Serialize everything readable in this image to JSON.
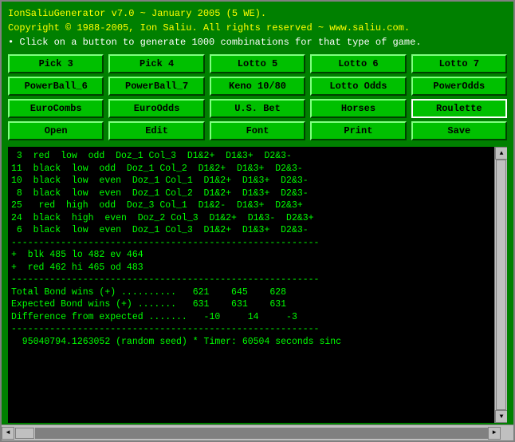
{
  "titlebar": {
    "line1": "IonSaliuGenerator v7.0 ~ January 2005 (5 WE).",
    "line2": "Copyright © 1988-2005, Ion Saliu. All rights reserved ~ www.saliu.com.",
    "line3": "• Click on a button to generate 1000 combinations for that type of game."
  },
  "rows": [
    [
      {
        "label": "Pick 3",
        "name": "pick3-button"
      },
      {
        "label": "Pick 4",
        "name": "pick4-button"
      },
      {
        "label": "Lotto 5",
        "name": "lotto5-button"
      },
      {
        "label": "Lotto 6",
        "name": "lotto6-button"
      },
      {
        "label": "Lotto 7",
        "name": "lotto7-button"
      }
    ],
    [
      {
        "label": "PowerBall_6",
        "name": "powerball6-button"
      },
      {
        "label": "PowerBall_7",
        "name": "powerball7-button"
      },
      {
        "label": "Keno 10/80",
        "name": "keno-button"
      },
      {
        "label": "Lotto Odds",
        "name": "lotto-odds-button"
      },
      {
        "label": "PowerOdds",
        "name": "power-odds-button"
      }
    ],
    [
      {
        "label": "EuroCombs",
        "name": "euro-combs-button"
      },
      {
        "label": "EuroOdds",
        "name": "euro-odds-button"
      },
      {
        "label": "U.S. Bet",
        "name": "us-bet-button"
      },
      {
        "label": "Horses",
        "name": "horses-button"
      },
      {
        "label": "Roulette",
        "name": "roulette-button",
        "special": true
      }
    ],
    [
      {
        "label": "Open",
        "name": "open-button"
      },
      {
        "label": "Edit",
        "name": "edit-button"
      },
      {
        "label": "Font",
        "name": "font-button"
      },
      {
        "label": "Print",
        "name": "print-button"
      },
      {
        "label": "Save",
        "name": "save-button"
      }
    ]
  ],
  "output": {
    "text": " 3  red  low  odd  Doz_1 Col_3  D1&2+  D1&3+  D2&3-\n11  black  low  odd  Doz_1 Col_2  D1&2+  D1&3+  D2&3-\n10  black  low  even  Doz_1 Col_1  D1&2+  D1&3+  D2&3-\n 8  black  low  even  Doz_1 Col_2  D1&2+  D1&3+  D2&3-\n25   red  high  odd  Doz_3 Col_1  D1&2-  D1&3+  D2&3+\n24  black  high  even  Doz_2 Col_3  D1&2+  D1&3-  D2&3+\n 6  black  low  even  Doz_1 Col_3  D1&2+  D1&3+  D2&3-\n--------------------------------------------------------\n+  blk 485 lo 482 ev 464\n+  red 462 hi 465 od 483\n--------------------------------------------------------\nTotal Bond wins (+) ..........   621    645    628\nExpected Bond wins (+) .......   631    631    631\nDifference from expected .......   -10     14     -3\n--------------------------------------------------------\n  95040794.1263052 (random seed) * Timer: 60504 seconds sinc"
  },
  "scrollbar": {
    "up_arrow": "▲",
    "down_arrow": "▼",
    "left_arrow": "◄",
    "right_arrow": "►"
  }
}
